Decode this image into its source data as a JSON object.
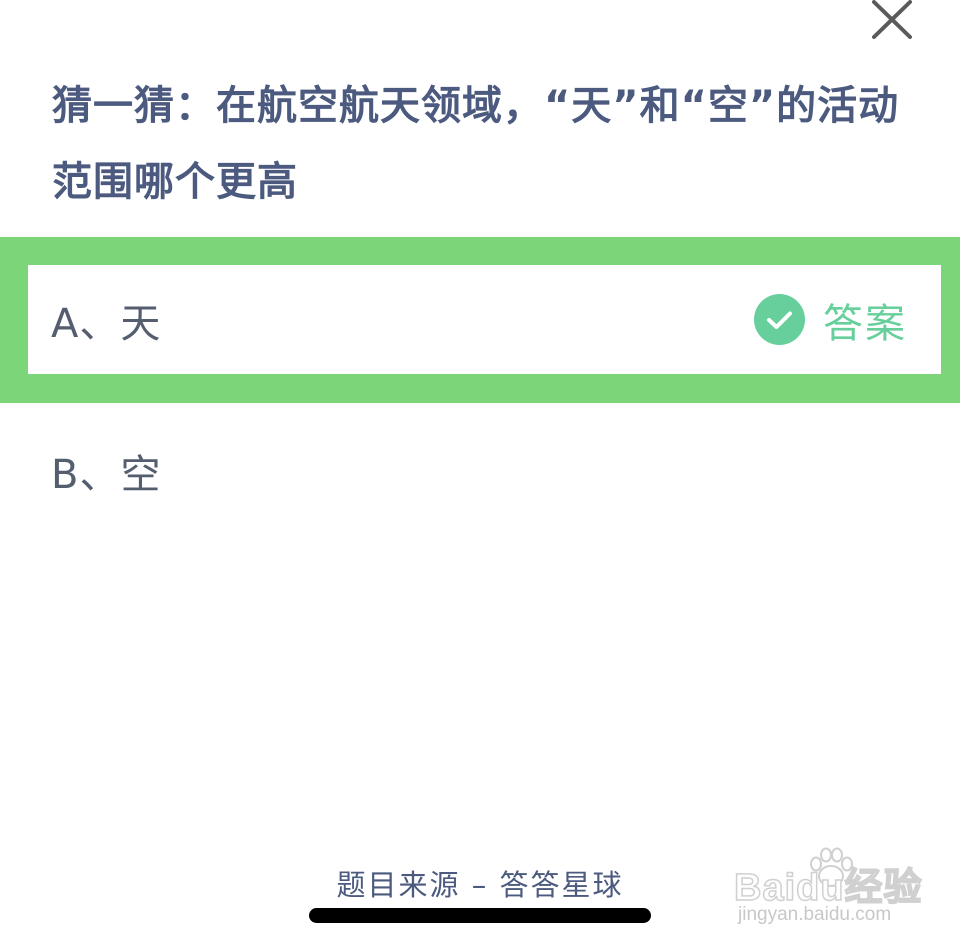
{
  "quiz": {
    "question": "猜一猜：在航空航天领域，“天”和“空”的活动范围哪个更高",
    "options": [
      {
        "label": "A、天",
        "is_answer": true
      },
      {
        "label": "B、空",
        "is_answer": false
      }
    ],
    "answer_label": "答案"
  },
  "footer": {
    "source": "题目来源 – 答答星球"
  },
  "watermark": {
    "brand": "Baidu经验",
    "url": "jingyan.baidu.com"
  },
  "colors": {
    "highlight_green": "#7cd679",
    "answer_green": "#66cf9c",
    "question_text": "#4b5a7e",
    "option_text": "#545e6e"
  },
  "icons": [
    "close-icon",
    "check-circle-icon",
    "baidu-paw-icon"
  ]
}
